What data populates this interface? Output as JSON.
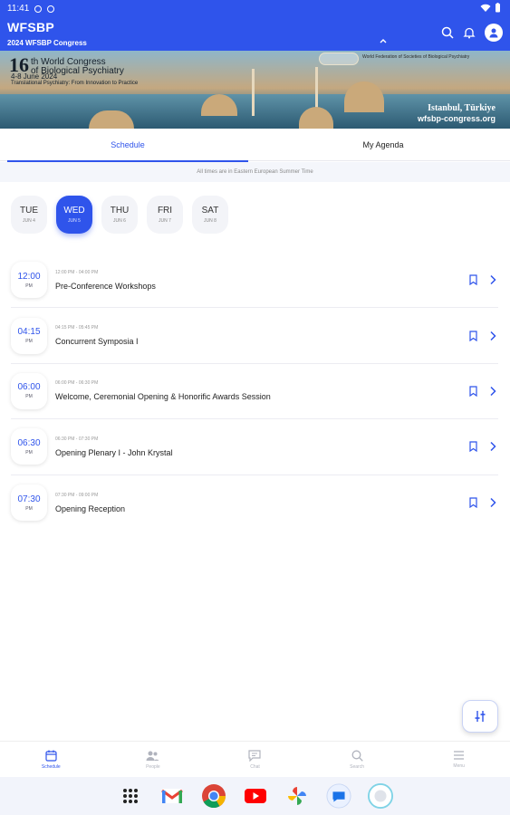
{
  "status_bar": {
    "time": "11:41"
  },
  "header": {
    "title": "WFSBP",
    "subtitle": "2024 WFSBP Congress"
  },
  "banner": {
    "number": "16",
    "line1": "th World Congress",
    "line2": "of Biological Psychiatry",
    "dates": "4-8 June 2024",
    "theme": "Translational Psychiatry: From Innovation to Practice",
    "org": "World Federation of Societies of Biological Psychiatry",
    "location": "Istanbul, Türkiye",
    "url": "wfsbp-congress.org"
  },
  "tabs": [
    {
      "label": "Schedule",
      "active": true
    },
    {
      "label": "My Agenda",
      "active": false
    }
  ],
  "timezone_note": "All times are in Eastern European Summer Time",
  "days": [
    {
      "name": "TUE",
      "date": "JUN 4",
      "selected": false
    },
    {
      "name": "WED",
      "date": "JUN 5",
      "selected": true
    },
    {
      "name": "THU",
      "date": "JUN 6",
      "selected": false
    },
    {
      "name": "FRI",
      "date": "JUN 7",
      "selected": false
    },
    {
      "name": "SAT",
      "date": "JUN 8",
      "selected": false
    }
  ],
  "sessions": [
    {
      "time": "12:00",
      "ampm": "PM",
      "range": "12:00 PM - 04:00 PM",
      "title": "Pre-Conference Workshops"
    },
    {
      "time": "04:15",
      "ampm": "PM",
      "range": "04:15 PM - 05:45 PM",
      "title": "Concurrent Symposia I"
    },
    {
      "time": "06:00",
      "ampm": "PM",
      "range": "06:00 PM - 06:30 PM",
      "title": "Welcome, Ceremonial Opening & Honorific Awards Session"
    },
    {
      "time": "06:30",
      "ampm": "PM",
      "range": "06:30 PM - 07:30 PM",
      "title": "Opening Plenary I - John Krystal"
    },
    {
      "time": "07:30",
      "ampm": "PM",
      "range": "07:30 PM - 09:00 PM",
      "title": "Opening Reception"
    }
  ],
  "bottom_nav": [
    {
      "label": "Schedule",
      "icon": "calendar-icon",
      "active": true
    },
    {
      "label": "People",
      "icon": "people-icon",
      "active": false
    },
    {
      "label": "Chat",
      "icon": "chat-icon",
      "active": false
    },
    {
      "label": "Search",
      "icon": "search-icon",
      "active": false
    },
    {
      "label": "Menu",
      "icon": "menu-icon",
      "active": false
    }
  ],
  "colors": {
    "accent": "#2f54eb",
    "header_bg": "#2f54eb"
  }
}
